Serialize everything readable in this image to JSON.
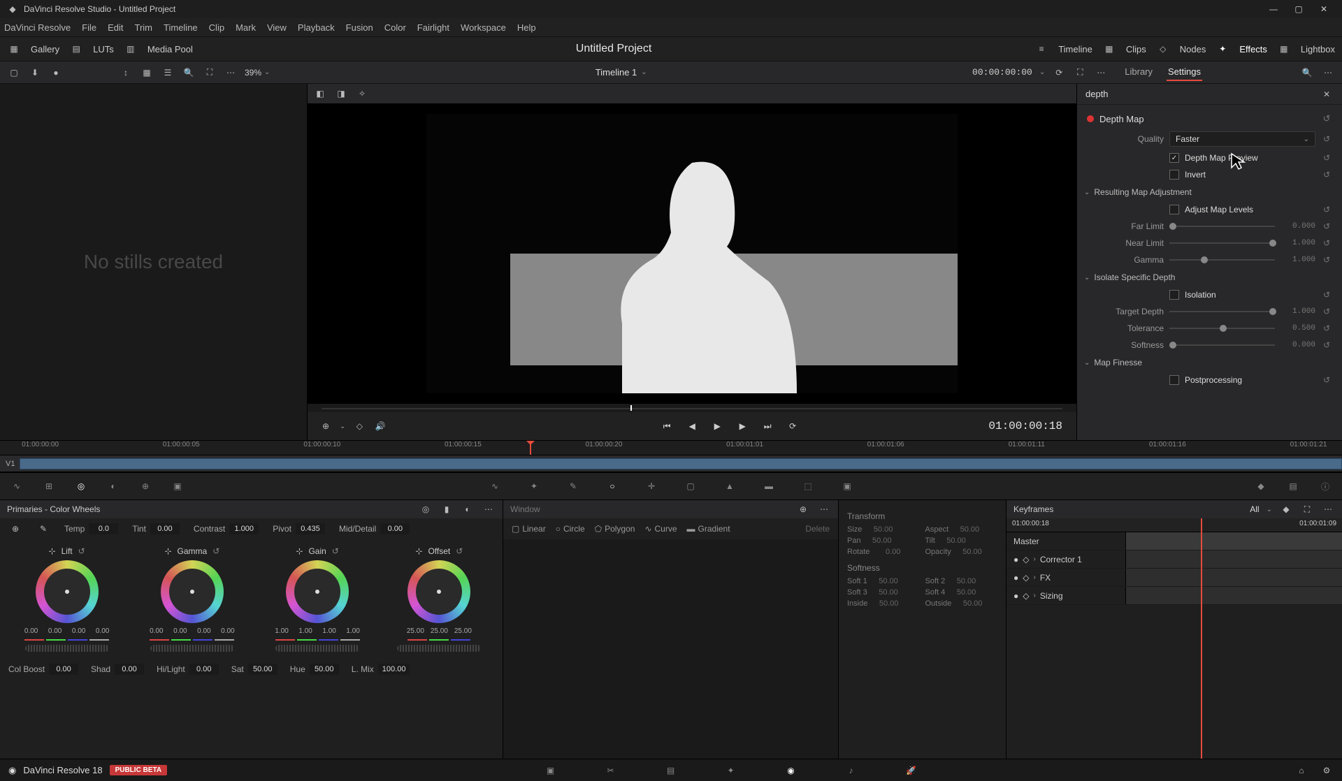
{
  "window_title": "DaVinci Resolve Studio - Untitled Project",
  "menus": [
    "DaVinci Resolve",
    "File",
    "Edit",
    "Trim",
    "Timeline",
    "Clip",
    "Mark",
    "View",
    "Playback",
    "Fusion",
    "Color",
    "Fairlight",
    "Workspace",
    "Help"
  ],
  "top_toolbar": {
    "gallery": "Gallery",
    "luts": "LUTs",
    "media_pool": "Media Pool",
    "timeline": "Timeline",
    "clips": "Clips",
    "nodes": "Nodes",
    "effects": "Effects",
    "lightbox": "Lightbox"
  },
  "project_title": "Untitled Project",
  "viewer": {
    "zoom": "39%",
    "timeline_name": "Timeline 1",
    "tc_small": "00:00:00:00",
    "tc_big": "01:00:00:18"
  },
  "inspector": {
    "tabs": {
      "library": "Library",
      "settings": "Settings"
    },
    "search": "depth",
    "fx_name": "Depth Map",
    "quality_label": "Quality",
    "quality_value": "Faster",
    "preview_label": "Depth Map Preview",
    "invert_label": "Invert",
    "sec_resulting": "Resulting Map Adjustment",
    "adjust_levels": "Adjust Map Levels",
    "far_limit": "Far Limit",
    "far_val": "0.000",
    "near_limit": "Near Limit",
    "near_val": "1.000",
    "gamma": "Gamma",
    "gamma_val": "1.000",
    "sec_isolate": "Isolate Specific Depth",
    "isolation": "Isolation",
    "target_depth": "Target Depth",
    "target_val": "1.000",
    "tolerance": "Tolerance",
    "tol_val": "0.500",
    "softness": "Softness",
    "soft_val": "0.000",
    "sec_finesse": "Map Finesse",
    "postprocessing": "Postprocessing"
  },
  "gallery": {
    "no_stills": "No stills created"
  },
  "ruler_ticks": [
    "01:00:00:00",
    "01:00:00:05",
    "01:00:00:10",
    "01:00:00:15",
    "01:00:00:20",
    "01:00:01:01",
    "01:00:01:06",
    "01:00:01:11",
    "01:00:01:16",
    "01:00:01:21"
  ],
  "track_label": "V1",
  "primaries": {
    "title": "Primaries - Color Wheels",
    "temp": "Temp",
    "temp_v": "0.0",
    "tint": "Tint",
    "tint_v": "0.00",
    "contrast": "Contrast",
    "contrast_v": "1.000",
    "pivot": "Pivot",
    "pivot_v": "0.435",
    "md": "Mid/Detail",
    "md_v": "0.00",
    "wheels": [
      {
        "name": "Lift",
        "vals": [
          "0.00",
          "0.00",
          "0.00",
          "0.00"
        ]
      },
      {
        "name": "Gamma",
        "vals": [
          "0.00",
          "0.00",
          "0.00",
          "0.00"
        ]
      },
      {
        "name": "Gain",
        "vals": [
          "1.00",
          "1.00",
          "1.00",
          "1.00"
        ]
      },
      {
        "name": "Offset",
        "vals": [
          "25.00",
          "25.00",
          "25.00"
        ]
      }
    ],
    "colboost": "Col Boost",
    "colboost_v": "0.00",
    "shad": "Shad",
    "shad_v": "0.00",
    "hilight": "Hi/Light",
    "hilight_v": "0.00",
    "sat": "Sat",
    "sat_v": "50.00",
    "hue": "Hue",
    "hue_v": "50.00",
    "lmix": "L. Mix",
    "lmix_v": "100.00"
  },
  "window_panel": {
    "title": "Window",
    "linear": "Linear",
    "circle": "Circle",
    "polygon": "Polygon",
    "curve": "Curve",
    "gradient": "Gradient",
    "delete": "Delete"
  },
  "transform": {
    "title": "Transform",
    "size": "Size",
    "size_v": "50.00",
    "aspect": "Aspect",
    "aspect_v": "50.00",
    "pan": "Pan",
    "pan_v": "50.00",
    "tilt": "Tilt",
    "tilt_v": "50.00",
    "rotate": "Rotate",
    "rotate_v": "0.00",
    "opacity": "Opacity",
    "opacity_v": "50.00",
    "softness": "Softness",
    "soft1": "Soft 1",
    "soft1_v": "50.00",
    "soft2": "Soft 2",
    "soft2_v": "50.00",
    "soft3": "Soft 3",
    "soft3_v": "50.00",
    "soft4": "Soft 4",
    "soft4_v": "50.00",
    "inside": "Inside",
    "inside_v": "50.00",
    "outside": "Outside",
    "outside_v": "50.00"
  },
  "keyframes": {
    "title": "Keyframes",
    "all": "All",
    "tc_l": "01:00:00:18",
    "tc_r": "01:00:01:09",
    "rows": [
      "Master",
      "Corrector 1",
      "FX",
      "Sizing"
    ]
  },
  "footer": {
    "product": "DaVinci Resolve 18",
    "beta": "PUBLIC BETA"
  }
}
